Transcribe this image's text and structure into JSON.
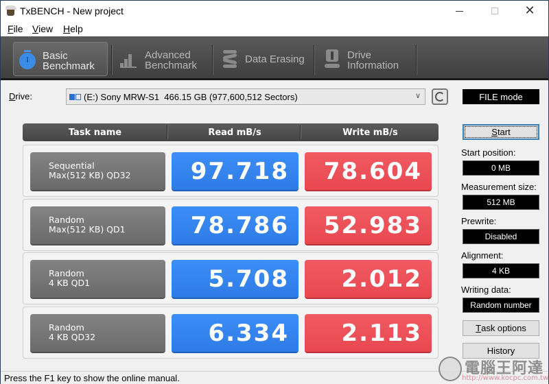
{
  "window": {
    "title": "TxBENCH - New project",
    "controls": {
      "minimize": "minimize",
      "maximize": "maximize",
      "close": "✕"
    }
  },
  "menu": [
    {
      "key": "F",
      "rest": "ile"
    },
    {
      "key": "V",
      "rest": "iew"
    },
    {
      "key": "H",
      "rest": "elp"
    }
  ],
  "toolbar": {
    "tabs": [
      {
        "line1": "Basic",
        "line2": "Benchmark",
        "icon": "stopwatch-icon",
        "active": true
      },
      {
        "line1": "Advanced",
        "line2": "Benchmark",
        "icon": "bar-chart-icon",
        "active": false
      },
      {
        "line1": "Data Erasing",
        "line2": "",
        "icon": "spring-icon",
        "active": false
      },
      {
        "line1": "Drive",
        "line2": "Information",
        "icon": "drive-info-icon",
        "active": false
      }
    ]
  },
  "drive": {
    "label_key": "D",
    "label_rest": "rive:",
    "selected": "(E:) Sony MRW-S1  466.15 GB (977,600,512 Sectors)",
    "mode": "FILE mode"
  },
  "table": {
    "headers": [
      "Task name",
      "Read mB/s",
      "Write mB/s"
    ],
    "rows": [
      {
        "task_line1": "Sequential",
        "task_line2": "Max(512 KB) QD32",
        "read": "97.718",
        "write": "78.604"
      },
      {
        "task_line1": "Random",
        "task_line2": "Max(512 KB) QD1",
        "read": "78.786",
        "write": "52.983"
      },
      {
        "task_line1": "Random",
        "task_line2": "4 KB QD1",
        "read": "5.708",
        "write": "2.012"
      },
      {
        "task_line1": "Random",
        "task_line2": "4 KB QD32",
        "read": "6.334",
        "write": "2.113"
      }
    ]
  },
  "panel": {
    "start": {
      "key": "S",
      "rest": "tart"
    },
    "params": [
      {
        "label": "Start position:",
        "value": "0 MB"
      },
      {
        "label": "Measurement size:",
        "value": "512 MB"
      },
      {
        "label": "Prewrite:",
        "value": "Disabled"
      },
      {
        "label": "Alignment:",
        "value": "4 KB"
      },
      {
        "label": "Writing data:",
        "value": "Random number"
      }
    ],
    "task_options": {
      "key": "T",
      "rest": "ask options"
    },
    "history": "History"
  },
  "status": "Press the F1 key to show the online manual.",
  "watermark": {
    "text": "電腦王阿達",
    "url": "http://www.kocpc.com.tw"
  },
  "colors": {
    "read": "#3d8ef7",
    "write": "#f15a62",
    "toolbar": "#4a4a4a",
    "accent_icon": "#3a8ce8"
  }
}
